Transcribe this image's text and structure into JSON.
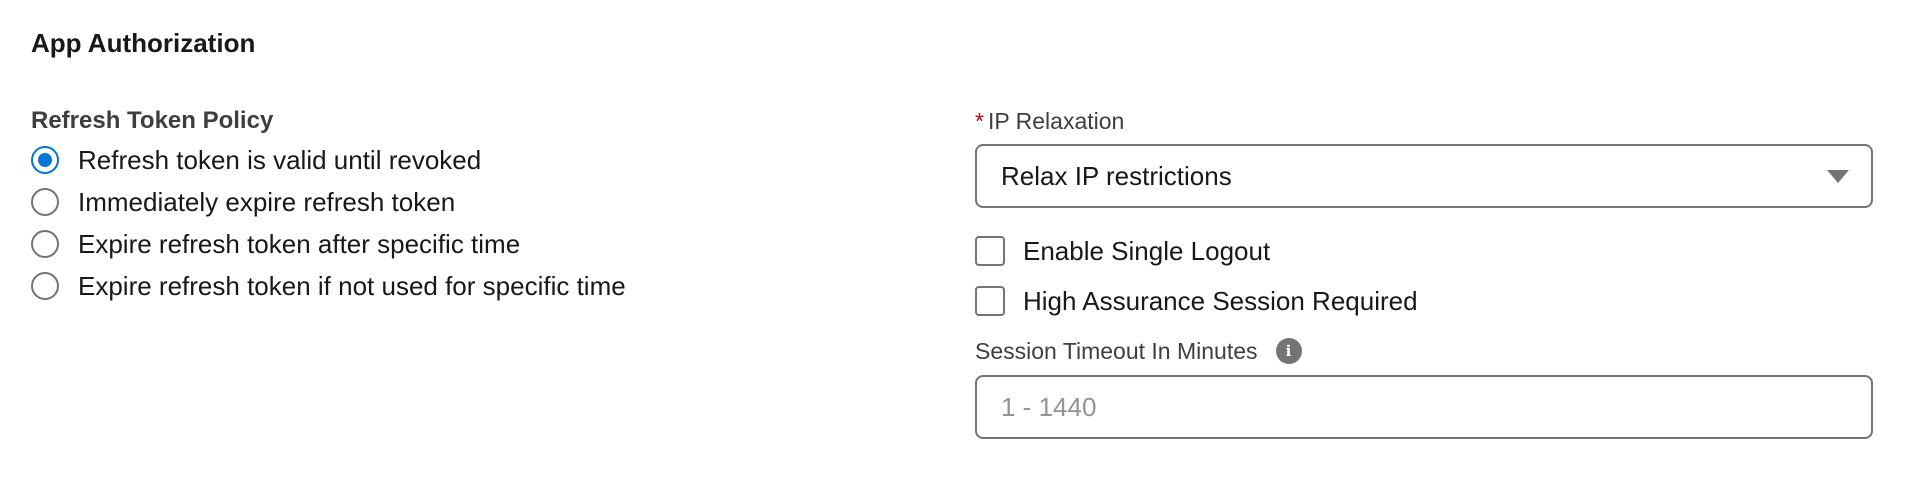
{
  "section": {
    "title": "App Authorization"
  },
  "refresh_token_policy": {
    "label": "Refresh Token Policy",
    "options": [
      {
        "label": "Refresh token is valid until revoked",
        "selected": true
      },
      {
        "label": "Immediately expire refresh token",
        "selected": false
      },
      {
        "label": "Expire refresh token after specific time",
        "selected": false
      },
      {
        "label": "Expire refresh token if not used for specific time",
        "selected": false
      }
    ]
  },
  "ip_relaxation": {
    "required_mark": "*",
    "label": "IP Relaxation",
    "value": "Relax IP restrictions"
  },
  "single_logout": {
    "label": "Enable Single Logout",
    "checked": false
  },
  "high_assurance": {
    "label": "High Assurance Session Required",
    "checked": false
  },
  "session_timeout": {
    "label": "Session Timeout In Minutes",
    "info_icon": "info-icon",
    "placeholder": "1 - 1440",
    "value": ""
  },
  "colors": {
    "accent": "#0176d3",
    "required": "#ba0517",
    "border": "#747474",
    "placeholder": "#939393"
  }
}
